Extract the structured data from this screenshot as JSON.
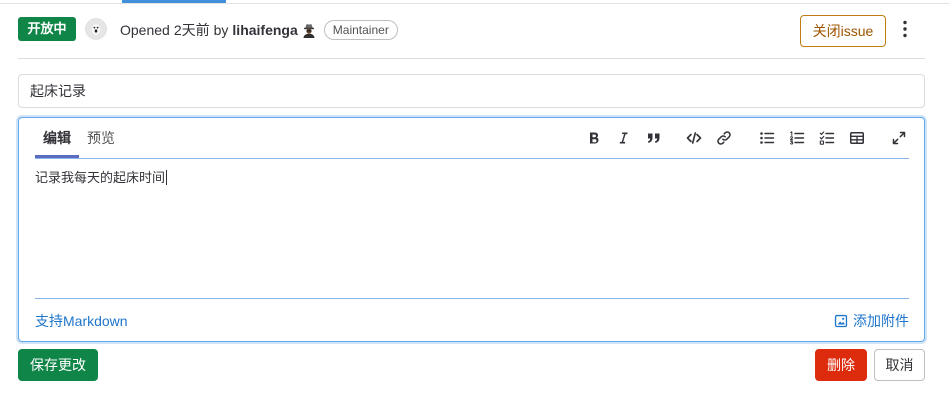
{
  "colors": {
    "success": "#108548",
    "danger": "#dd2b0e",
    "link": "#1f75cb",
    "warning_border": "#c17d10",
    "warning_text": "#9e5400",
    "focus": "#63a6e9",
    "tab_active": "#5c6bc0"
  },
  "header": {
    "status": "开放中",
    "avatar_icon": "user-avatar-icon",
    "opened_label": "Opened",
    "time_ago": "2天前",
    "by_label": "by",
    "author": "lihaifenga",
    "author_status_icon": "user-status-emoji-icon",
    "role_badge": "Maintainer",
    "close_button": "关闭issue",
    "more_actions_icon": "kebab-menu-icon"
  },
  "title_field": {
    "value": "起床记录"
  },
  "editor": {
    "tabs": [
      {
        "label": "编辑",
        "active": true
      },
      {
        "label": "预览",
        "active": false
      }
    ],
    "toolbar": [
      "bold-icon",
      "italic-icon",
      "quote-icon",
      "code-icon",
      "link-icon",
      "bulleted-list-icon",
      "numbered-list-icon",
      "task-list-icon",
      "table-icon",
      "fullscreen-icon"
    ],
    "content": "记录我每天的起床时间",
    "markdown_link": "支持Markdown",
    "attach_icon": "image-icon",
    "attach_label": "添加附件"
  },
  "actions": {
    "save": "保存更改",
    "delete": "删除",
    "cancel": "取消"
  }
}
